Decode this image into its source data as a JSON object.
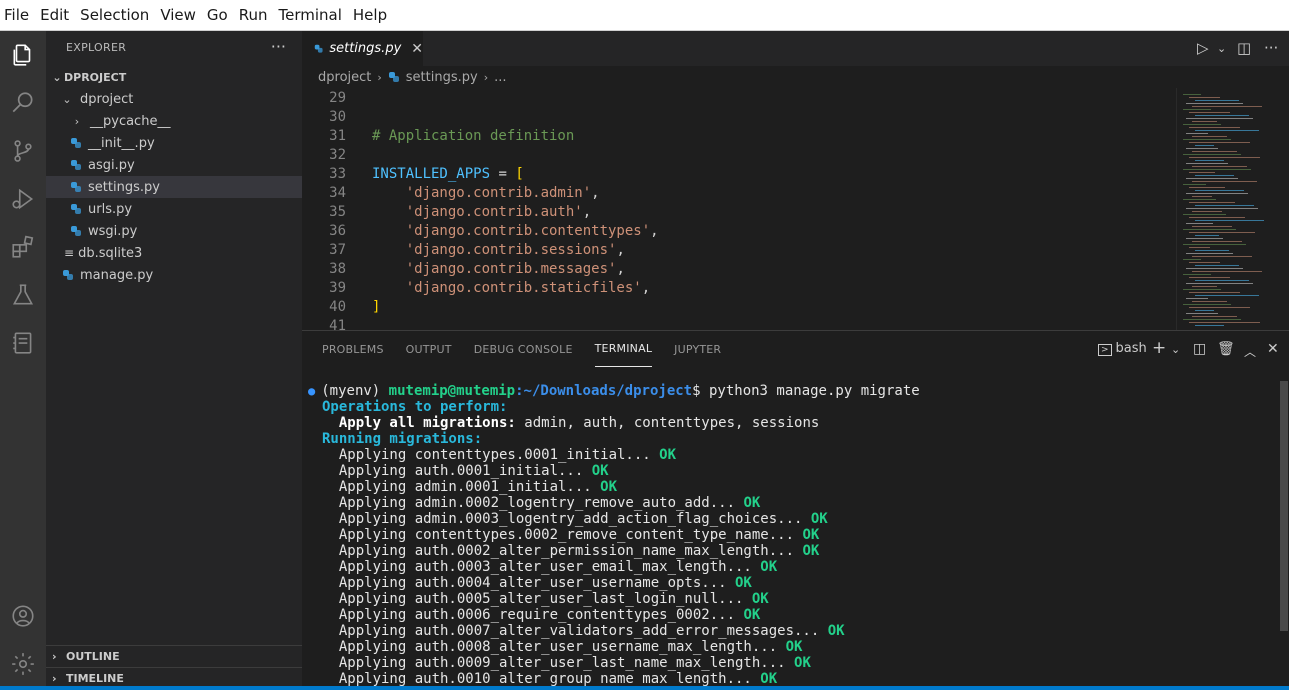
{
  "menubar": {
    "items": [
      "File",
      "Edit",
      "Selection",
      "View",
      "Go",
      "Run",
      "Terminal",
      "Help"
    ]
  },
  "activity_bar": {
    "icons": [
      "explorer-icon",
      "search-icon",
      "source-control-icon",
      "run-debug-icon",
      "extensions-icon",
      "testing-icon",
      "jupyter-icon",
      "account-icon",
      "gear-icon"
    ]
  },
  "explorer": {
    "title": "EXPLORER",
    "more": "···",
    "root": "DPROJECT",
    "items": [
      {
        "label": "dproject",
        "kind": "folder-open"
      },
      {
        "label": "__pycache__",
        "kind": "folder-closed"
      },
      {
        "label": "__init__.py",
        "kind": "python"
      },
      {
        "label": "asgi.py",
        "kind": "python"
      },
      {
        "label": "settings.py",
        "kind": "python"
      },
      {
        "label": "urls.py",
        "kind": "python"
      },
      {
        "label": "wsgi.py",
        "kind": "python"
      },
      {
        "label": "db.sqlite3",
        "kind": "database"
      },
      {
        "label": "manage.py",
        "kind": "python"
      }
    ],
    "outline": "OUTLINE",
    "timeline": "TIMELINE"
  },
  "editor": {
    "tab_label": "settings.py",
    "tab_close": "✕",
    "breadcrumb": [
      "dproject",
      "settings.py",
      "..."
    ],
    "lines": [
      {
        "n": "29",
        "tokens": []
      },
      {
        "n": "30",
        "tokens": []
      },
      {
        "n": "31",
        "tokens": [
          {
            "t": "# Application definition",
            "c": "comment"
          }
        ]
      },
      {
        "n": "32",
        "tokens": []
      },
      {
        "n": "33",
        "tokens": [
          {
            "t": "INSTALLED_APPS",
            "c": "var"
          },
          {
            "t": " = ",
            "c": "op"
          },
          {
            "t": "[",
            "c": "bracket"
          }
        ]
      },
      {
        "n": "34",
        "tokens": [
          {
            "t": "    ",
            "c": "op"
          },
          {
            "t": "'django.contrib.admin'",
            "c": "str"
          },
          {
            "t": ",",
            "c": "op"
          }
        ]
      },
      {
        "n": "35",
        "tokens": [
          {
            "t": "    ",
            "c": "op"
          },
          {
            "t": "'django.contrib.auth'",
            "c": "str"
          },
          {
            "t": ",",
            "c": "op"
          }
        ]
      },
      {
        "n": "36",
        "tokens": [
          {
            "t": "    ",
            "c": "op"
          },
          {
            "t": "'django.contrib.contenttypes'",
            "c": "str"
          },
          {
            "t": ",",
            "c": "op"
          }
        ]
      },
      {
        "n": "37",
        "tokens": [
          {
            "t": "    ",
            "c": "op"
          },
          {
            "t": "'django.contrib.sessions'",
            "c": "str"
          },
          {
            "t": ",",
            "c": "op"
          }
        ]
      },
      {
        "n": "38",
        "tokens": [
          {
            "t": "    ",
            "c": "op"
          },
          {
            "t": "'django.contrib.messages'",
            "c": "str"
          },
          {
            "t": ",",
            "c": "op"
          }
        ]
      },
      {
        "n": "39",
        "tokens": [
          {
            "t": "    ",
            "c": "op"
          },
          {
            "t": "'django.contrib.staticfiles'",
            "c": "str"
          },
          {
            "t": ",",
            "c": "op"
          }
        ]
      },
      {
        "n": "40",
        "tokens": [
          {
            "t": "]",
            "c": "bracket"
          }
        ]
      },
      {
        "n": "41",
        "tokens": []
      }
    ]
  },
  "panel": {
    "tabs": [
      "PROBLEMS",
      "OUTPUT",
      "DEBUG CONSOLE",
      "TERMINAL",
      "JUPYTER"
    ],
    "active_tab": "TERMINAL",
    "shell": "bash"
  },
  "terminal": {
    "prompt": {
      "env": "(myenv) ",
      "user_host": "mutemip@mutemip",
      "path": ":~/Downloads/dproject",
      "command": "$ python3 manage.py migrate"
    },
    "ops_header": "Operations to perform:",
    "apply_label": "  Apply all migrations:",
    "apply_value": " admin, auth, contenttypes, sessions",
    "running_header": "Running migrations:",
    "migrations": [
      "  Applying contenttypes.0001_initial...",
      "  Applying auth.0001_initial...",
      "  Applying admin.0001_initial...",
      "  Applying admin.0002_logentry_remove_auto_add...",
      "  Applying admin.0003_logentry_add_action_flag_choices...",
      "  Applying contenttypes.0002_remove_content_type_name...",
      "  Applying auth.0002_alter_permission_name_max_length...",
      "  Applying auth.0003_alter_user_email_max_length...",
      "  Applying auth.0004_alter_user_username_opts...",
      "  Applying auth.0005_alter_user_last_login_null...",
      "  Applying auth.0006_require_contenttypes_0002...",
      "  Applying auth.0007_alter_validators_add_error_messages...",
      "  Applying auth.0008_alter_user_username_max_length...",
      "  Applying auth.0009_alter_user_last_name_max_length...",
      "  Applying auth.0010_alter_group_name_max_length..."
    ],
    "ok_label": " OK"
  },
  "colors": {
    "accent": "#007acc",
    "python_icon": "#3a9ad9",
    "string": "#ce9178",
    "comment": "#6a9955",
    "variable": "#4fc1ff",
    "ok_green": "#23d18b"
  }
}
